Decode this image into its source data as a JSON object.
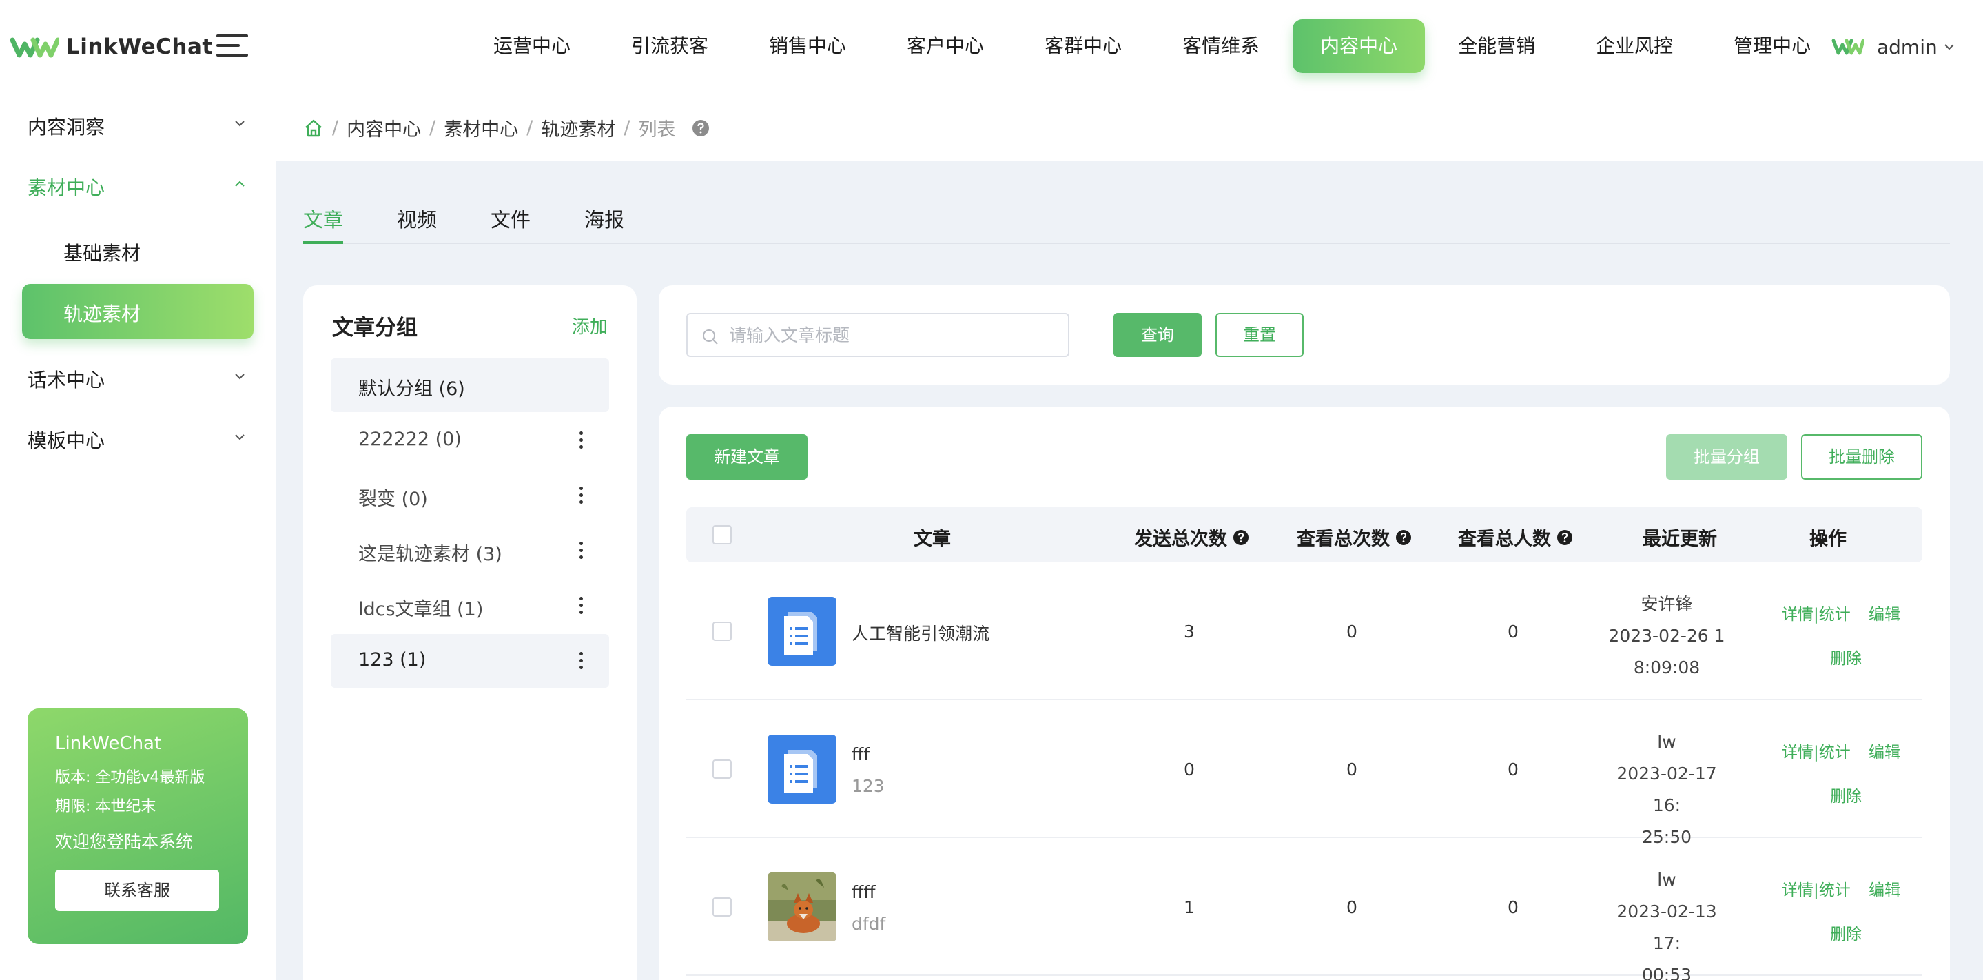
{
  "header": {
    "brand": "LinkWeChat",
    "nav": [
      "运营中心",
      "引流获客",
      "销售中心",
      "客户中心",
      "客群中心",
      "客情维系",
      "内容中心",
      "全能营销",
      "企业风控",
      "管理中心"
    ],
    "active_nav": "内容中心",
    "user": "admin",
    "accent": "#5dc26b"
  },
  "sidebar": {
    "items": [
      {
        "label": "内容洞察"
      },
      {
        "label": "素材中心"
      },
      {
        "label": "话术中心"
      },
      {
        "label": "模板中心"
      }
    ],
    "sub_items": [
      {
        "label": "基础素材"
      },
      {
        "label": "轨迹素材"
      }
    ],
    "promo": {
      "title": "LinkWeChat",
      "version": "版本: 全功能v4最新版",
      "period": "期限: 本世纪末",
      "welcome": "欢迎您登陆本系统",
      "button": "联系客服"
    }
  },
  "breadcrumb": [
    "内容中心",
    "素材中心",
    "轨迹素材",
    "列表"
  ],
  "tabs": [
    "文章",
    "视频",
    "文件",
    "海报"
  ],
  "groups": {
    "title": "文章分组",
    "add_label": "添加",
    "items": [
      "默认分组 (6)",
      "222222 (0)",
      "裂变 (0)",
      "这是轨迹素材 (3)",
      "ldcs文章组 (1)",
      "123 (1)"
    ]
  },
  "search": {
    "placeholder": "请输入文章标题",
    "query_label": "查询",
    "reset_label": "重置"
  },
  "list": {
    "new_label": "新建文章",
    "batch_group_label": "批量分组",
    "batch_delete_label": "批量删除",
    "columns": [
      "文章",
      "发送总次数",
      "查看总次数",
      "查看总人数",
      "最近更新",
      "操作"
    ],
    "rows": [
      {
        "title": "人工智能引领潮流",
        "subtitle": "",
        "sent": "3",
        "views": "0",
        "viewers": "0",
        "updater": "安许锋",
        "date1": "2023-02-26 1",
        "date2": "8:09:08",
        "thumb": "doc-icon"
      },
      {
        "title": "fff",
        "subtitle": "123",
        "sent": "0",
        "views": "0",
        "viewers": "0",
        "updater": "lw",
        "date1": "2023-02-17 16:",
        "date2": "25:50",
        "thumb": "doc-icon"
      },
      {
        "title": "ffff",
        "subtitle": "dfdf",
        "sent": "1",
        "views": "0",
        "viewers": "0",
        "updater": "lw",
        "date1": "2023-02-13 17:",
        "date2": "00:53",
        "thumb": "fox-photo"
      }
    ],
    "actions": {
      "detail": "详情|统计",
      "edit": "编辑",
      "delete": "删除"
    }
  }
}
